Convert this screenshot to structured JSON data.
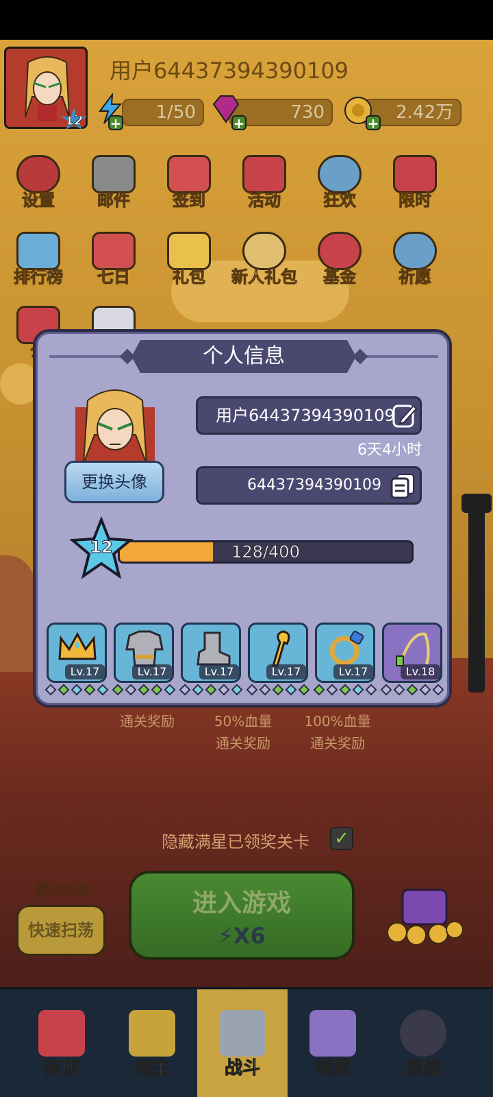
{
  "status_bar": {},
  "top_bar": {
    "username": "用户6443739439010​9",
    "avatar_level": "12",
    "energy": "1/50",
    "gems": "730",
    "gold": "2.42万"
  },
  "grid": {
    "row1": [
      "设置",
      "邮件",
      "签到",
      "活动",
      "狂欢",
      "限时"
    ],
    "row2": [
      "排行榜",
      "七日",
      "礼包",
      "新人礼包",
      "基金",
      "祈愿"
    ],
    "row3": [
      "公"
    ]
  },
  "stage": {
    "reward1": "通关奖励",
    "reward2_line1": "50%血量",
    "reward2_line2": "通关奖励",
    "reward3_line1": "100%血量",
    "reward3_line2": "通关奖励",
    "hide_stars_label": "隐藏满星已领奖关卡",
    "stage_label": "第20关",
    "sweep_label": "快速扫荡",
    "enter_label": "进入游戏",
    "enter_cost": "X6"
  },
  "bottom_nav": {
    "tabs": [
      {
        "label": "商店"
      },
      {
        "label": "城主"
      },
      {
        "label": "战斗"
      },
      {
        "label": "城堡"
      },
      {
        "label": "挑战"
      }
    ]
  },
  "modal": {
    "title": "个人信息",
    "change_avatar_label": "更换头像",
    "name_value": "用户64437394390109",
    "time_text": "6天4小时",
    "id_value": "64437394390109",
    "level": "12",
    "exp_text": "128/400",
    "exp_progress": 0.32,
    "equipment": [
      {
        "name": "crown",
        "level": "Lv.17",
        "rarity": "blue"
      },
      {
        "name": "armor",
        "level": "Lv.17",
        "rarity": "blue"
      },
      {
        "name": "boots",
        "level": "Lv.17",
        "rarity": "blue"
      },
      {
        "name": "staff",
        "level": "Lv.17",
        "rarity": "blue"
      },
      {
        "name": "ring",
        "level": "Lv.17",
        "rarity": "blue"
      },
      {
        "name": "whip",
        "level": "Lv.18",
        "rarity": "purple"
      }
    ]
  },
  "colors": {
    "modal_bg": "#a8a6cc",
    "modal_dark": "#4b4870",
    "exp_fill": "#f2a93a",
    "slot_blue": "#67b6d8",
    "slot_purple": "#8a72c2"
  }
}
